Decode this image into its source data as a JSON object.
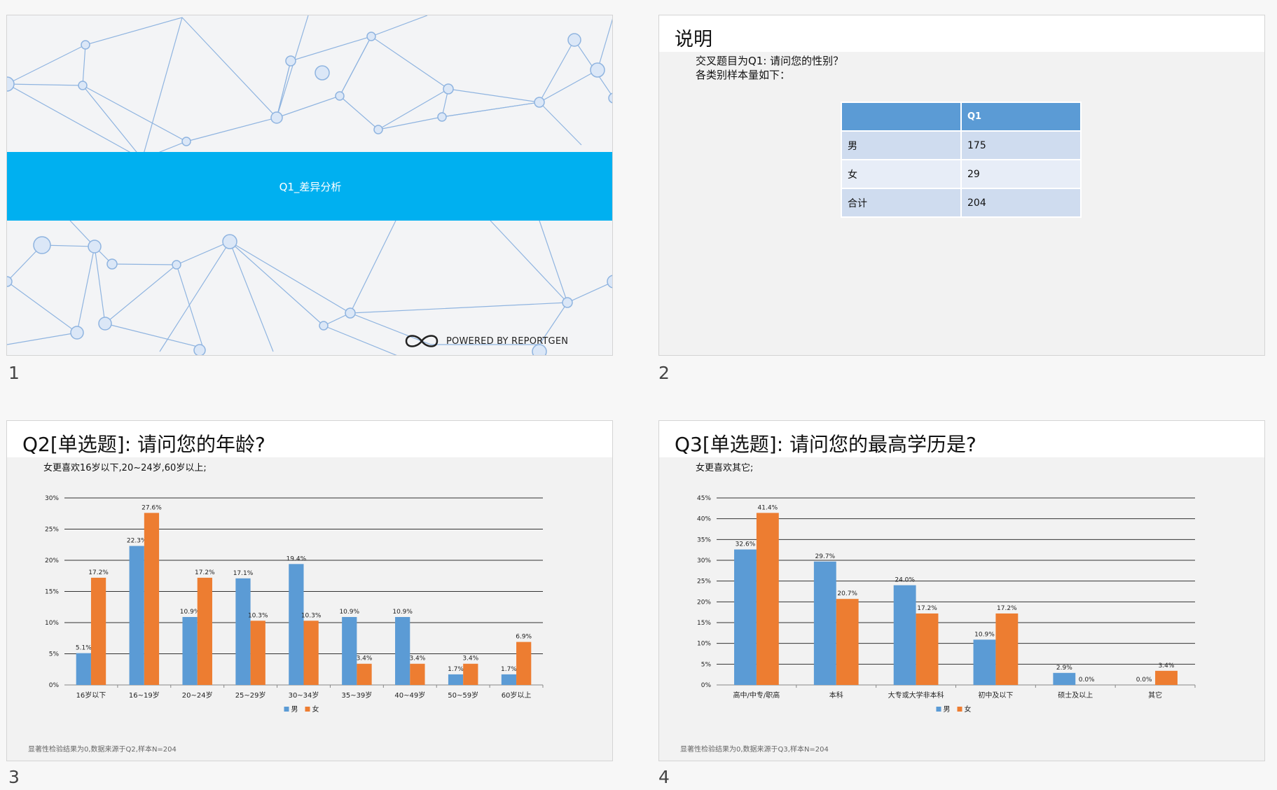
{
  "slide_numbers": [
    "1",
    "2",
    "3",
    "4"
  ],
  "slide1": {
    "banner_title": "Q1_差异分析",
    "powered_by": "POWERED BY REPORTGEN"
  },
  "slide2": {
    "title": "说明",
    "desc_line1": "交叉题目为Q1: 请问您的性别？",
    "desc_line2": "各类别样本量如下：",
    "table": {
      "header": [
        "",
        "Q1"
      ],
      "rows": [
        [
          "男",
          "175"
        ],
        [
          "女",
          "29"
        ],
        [
          "合计",
          "204"
        ]
      ]
    }
  },
  "slide3": {
    "title": "Q2[单选题]: 请问您的年龄?",
    "subtitle": "女更喜欢16岁以下,20~24岁,60岁以上;",
    "note": "显著性检验结果为0,数据来源于Q2,样本N=204"
  },
  "slide4": {
    "title": "Q3[单选题]: 请问您的最高学历是?",
    "subtitle": "女更喜欢其它;",
    "note": "显著性检验结果为0,数据来源于Q3,样本N=204"
  },
  "colors": {
    "male": "#5b9bd5",
    "female": "#ed7d31",
    "banner": "#00b0f0",
    "header": "#5b9bd5"
  },
  "chart_data": [
    {
      "type": "bar",
      "categories": [
        "16岁以下",
        "16~19岁",
        "20~24岁",
        "25~29岁",
        "30~34岁",
        "35~39岁",
        "40~49岁",
        "50~59岁",
        "60岁以上"
      ],
      "series": [
        {
          "name": "男",
          "values": [
            5.1,
            22.3,
            10.9,
            17.1,
            19.4,
            10.9,
            10.9,
            1.7,
            1.7
          ],
          "labels": [
            "5.1%",
            "22.3%",
            "10.9%",
            "17.1%",
            "19.4%",
            "10.9%",
            "10.9%",
            "1.7%",
            "1.7%"
          ]
        },
        {
          "name": "女",
          "values": [
            17.2,
            27.6,
            17.2,
            10.3,
            10.3,
            3.4,
            3.4,
            3.4,
            6.9
          ],
          "labels": [
            "17.2%",
            "27.6%",
            "17.2%",
            "10.3%",
            "10.3%",
            "3.4%",
            "3.4%",
            "3.4%",
            "6.9%"
          ]
        }
      ],
      "yticks": [
        "0%",
        "5%",
        "10%",
        "15%",
        "20%",
        "25%",
        "30%"
      ],
      "ylim": [
        0,
        30
      ],
      "grid": true,
      "legend": "bottom"
    },
    {
      "type": "bar",
      "categories": [
        "高中/中专/职高",
        "本科",
        "大专或大学非本科",
        "初中及以下",
        "硕士及以上",
        "其它"
      ],
      "series": [
        {
          "name": "男",
          "values": [
            32.6,
            29.7,
            24.0,
            10.9,
            2.9,
            0.0
          ],
          "labels": [
            "32.6%",
            "29.7%",
            "24.0%",
            "10.9%",
            "2.9%",
            "0.0%"
          ]
        },
        {
          "name": "女",
          "values": [
            41.4,
            20.7,
            17.2,
            17.2,
            0.0,
            3.4
          ],
          "labels": [
            "41.4%",
            "20.7%",
            "17.2%",
            "17.2%",
            "0.0%",
            "3.4%"
          ]
        }
      ],
      "yticks": [
        "0%",
        "5%",
        "10%",
        "15%",
        "20%",
        "25%",
        "30%",
        "35%",
        "40%",
        "45%"
      ],
      "ylim": [
        0,
        45
      ],
      "grid": true,
      "legend": "bottom"
    }
  ]
}
